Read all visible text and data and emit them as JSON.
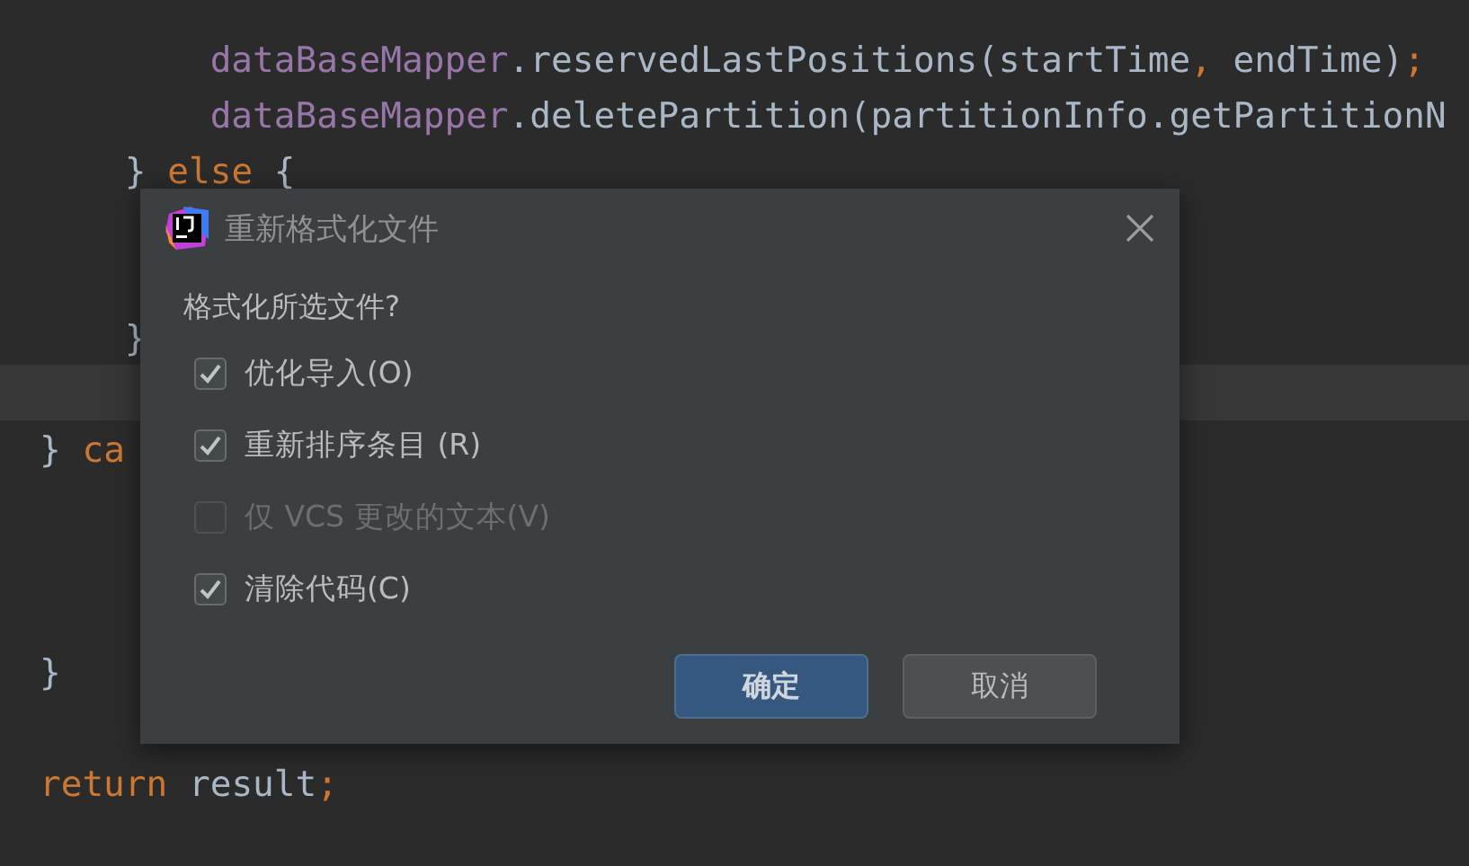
{
  "editor": {
    "lines": [
      {
        "current": false,
        "tokens": [
          {
            "kind": "field",
            "text": "        dataBaseMapper"
          },
          {
            "kind": "plain",
            "text": ".reservedLastPositions(startTime"
          },
          {
            "kind": "punct",
            "text": ","
          },
          {
            "kind": "plain",
            "text": " endTime)"
          },
          {
            "kind": "punct",
            "text": ";"
          }
        ]
      },
      {
        "current": false,
        "tokens": [
          {
            "kind": "field",
            "text": "        dataBaseMapper"
          },
          {
            "kind": "plain",
            "text": ".deletePartition(partitionInfo.getPartitionN"
          }
        ]
      },
      {
        "current": false,
        "tokens": [
          {
            "kind": "plain",
            "text": "    }"
          },
          {
            "kind": "keyword",
            "text": " else"
          },
          {
            "kind": "plain",
            "text": " {"
          }
        ]
      },
      {
        "current": false
      },
      {
        "current": false
      },
      {
        "current": false,
        "tokens": [
          {
            "kind": "plain",
            "text": "    }"
          }
        ]
      },
      {
        "current": true
      },
      {
        "current": false,
        "tokens": [
          {
            "kind": "plain",
            "text": "}"
          },
          {
            "kind": "keyword",
            "text": " ca"
          }
        ]
      },
      {
        "current": false
      },
      {
        "current": false
      },
      {
        "current": false
      },
      {
        "current": false,
        "tokens": [
          {
            "kind": "plain",
            "text": "}"
          }
        ]
      },
      {
        "current": false
      },
      {
        "current": false,
        "tokens": [
          {
            "kind": "keyword",
            "text": "return"
          },
          {
            "kind": "plain",
            "text": " result"
          },
          {
            "kind": "punct",
            "text": ";"
          }
        ]
      }
    ]
  },
  "dialog": {
    "title": "重新格式化文件",
    "prompt": "格式化所选文件?",
    "options": [
      {
        "label": "优化导入(O)",
        "checked": true,
        "disabled": false
      },
      {
        "label": "重新排序条目 (R)",
        "checked": true,
        "disabled": false
      },
      {
        "label": "仅 VCS 更改的文本(V)",
        "checked": false,
        "disabled": true
      },
      {
        "label": "清除代码(C)",
        "checked": true,
        "disabled": false
      }
    ],
    "buttons": [
      {
        "label": "确定",
        "kind": "primary"
      },
      {
        "label": "取消",
        "kind": "secondary"
      }
    ]
  }
}
